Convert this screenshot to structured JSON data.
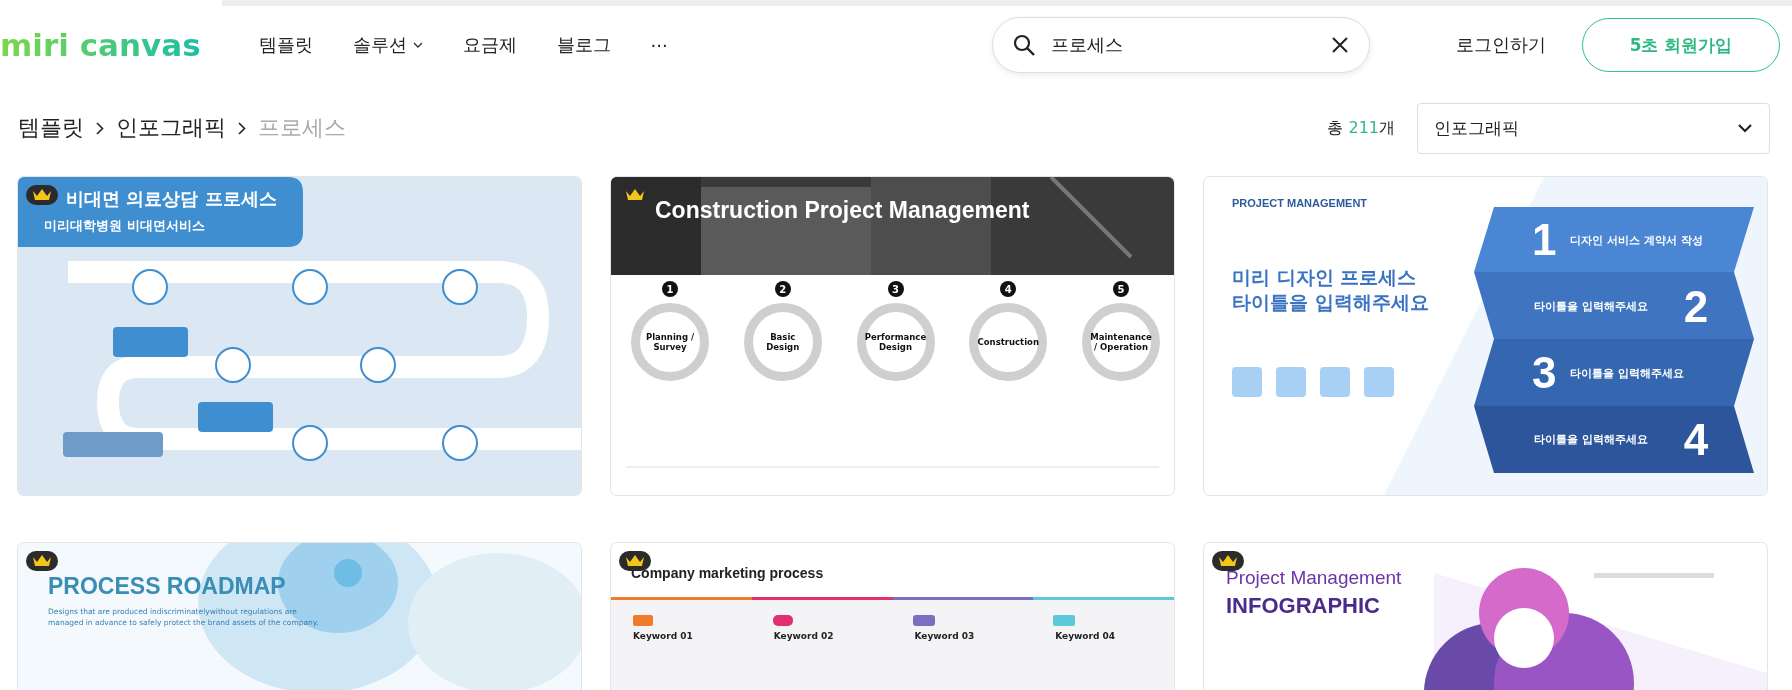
{
  "header": {
    "logo": "miri canvas",
    "nav": [
      {
        "label": "템플릿",
        "dropdown": false
      },
      {
        "label": "솔루션",
        "dropdown": true
      },
      {
        "label": "요금제",
        "dropdown": false
      },
      {
        "label": "블로그",
        "dropdown": false
      },
      {
        "label": "···",
        "dropdown": false
      }
    ],
    "search": {
      "value": "프로세스"
    },
    "login": "로그인하기",
    "signup": "5초 회원가입"
  },
  "breadcrumb": [
    {
      "label": "템플릿",
      "current": false
    },
    {
      "label": "인포그래픽",
      "current": false
    },
    {
      "label": "프로세스",
      "current": true
    }
  ],
  "total": {
    "prefix": "총",
    "count": "211",
    "suffix": "개"
  },
  "category_select": {
    "value": "인포그래픽"
  },
  "cards": [
    {
      "kind": "medical",
      "premium": true,
      "title": "비대면 의료상담 프로세스",
      "subtitle": "미리대학병원 비대면서비스"
    },
    {
      "kind": "construction",
      "premium": true,
      "title": "Construction Project Management",
      "steps": [
        {
          "number": "1",
          "label": "Planning / Survey"
        },
        {
          "number": "2",
          "label": "Basic Design"
        },
        {
          "number": "3",
          "label": "Performance Design"
        },
        {
          "number": "4",
          "label": "Construction"
        },
        {
          "number": "5",
          "label": "Maintenance / Operation"
        }
      ]
    },
    {
      "kind": "chevrons",
      "premium": false,
      "eyebrow": "PROJECT MANAGEMENT",
      "title": "미리 디자인 프로세스\n타이틀을 입력해주세요",
      "steps": [
        {
          "number": "1",
          "label": "디자인 서비스 계약서 작성"
        },
        {
          "number": "2",
          "label": "타이틀을 입력해주세요"
        },
        {
          "number": "3",
          "label": "타이틀을 입력해주세요"
        },
        {
          "number": "4",
          "label": "타이틀을 입력해주세요"
        }
      ]
    },
    {
      "kind": "roadmap",
      "premium": true,
      "title": "PROCESS ROADMAP",
      "subtitle": "Designs that are produced indiscriminatelywithout regulations are\nmanaged in advance to safely protect the brand assets of the company."
    },
    {
      "kind": "marketing",
      "premium": true,
      "title": "Company marketing process",
      "steps": [
        {
          "label": "Keyword 01",
          "color": "#f07b2b"
        },
        {
          "label": "Keyword 02",
          "color": "#e0306e"
        },
        {
          "label": "Keyword 03",
          "color": "#7a6fc0"
        },
        {
          "label": "Keyword 04",
          "color": "#5cc8d8"
        }
      ]
    },
    {
      "kind": "infographic",
      "premium": true,
      "title": "Project Management",
      "subtitle": "INFOGRAPHIC"
    }
  ]
}
